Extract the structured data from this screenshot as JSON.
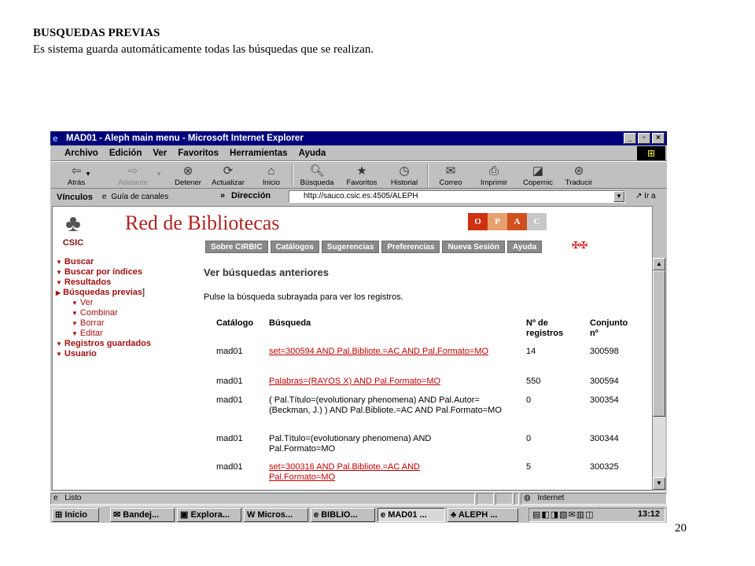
{
  "doc": {
    "title": "BUSQUEDAS PREVIAS",
    "text": "Es sistema guarda automáticamente todas las búsquedas que se realizan.",
    "page_number": "20"
  },
  "window": {
    "title": "MAD01 - Aleph main menu - Microsoft Internet Explorer",
    "menu": [
      "Archivo",
      "Edición",
      "Ver",
      "Favoritos",
      "Herramientas",
      "Ayuda"
    ],
    "toolbar": [
      "Atrás",
      "Adelante",
      "Detener",
      "Actualizar",
      "Inicio",
      "Búsqueda",
      "Favoritos",
      "Historial",
      "Correo",
      "Imprimir",
      "Copernic",
      "Traducir"
    ],
    "links_label": "Vínculos",
    "channel_guide": "Guía de canales",
    "address_label": "Dirección",
    "url": "http://sauco.csic.es:4505/ALEPH",
    "go_label": "Ir a"
  },
  "site": {
    "logo_text": "CSIC",
    "brand": "Red de Bibliotecas",
    "opac": [
      "O",
      "P",
      "A",
      "C"
    ],
    "nav": [
      "Sobre CIRBIC",
      "Catálogos",
      "Sugerencias",
      "Preferencias",
      "Nueva Sesión",
      "Ayuda"
    ]
  },
  "sidebar": [
    {
      "label": "Buscar",
      "sub": false
    },
    {
      "label": "Buscar por índices",
      "sub": false
    },
    {
      "label": "Resultados",
      "sub": false
    },
    {
      "label": "Búsquedas previas",
      "sub": false,
      "active": true
    },
    {
      "label": "Ver",
      "sub": true
    },
    {
      "label": "Combinar",
      "sub": true
    },
    {
      "label": "Borrar",
      "sub": true
    },
    {
      "label": "Editar",
      "sub": true
    },
    {
      "label": "Registros guardados",
      "sub": false
    },
    {
      "label": "Usuario",
      "sub": false
    }
  ],
  "main": {
    "heading": "Ver búsquedas anteriores",
    "hint": "Pulse la búsqueda subrayada para ver los registros.",
    "columns": [
      "Catálogo",
      "Búsqueda",
      "Nº de registros",
      "Conjunto nº"
    ],
    "rows": [
      {
        "catalog": "mad01",
        "query": "set=300594 AND Pal.Bibliote.=AC AND Pal.Formato=MO",
        "link": true,
        "records": "14",
        "set": "300598"
      },
      {
        "catalog": "mad01",
        "query": "Palabras=(RAYOS X) AND Pal.Formato=MO",
        "link": true,
        "records": "550",
        "set": "300594"
      },
      {
        "catalog": "mad01",
        "query": "( Pal.Título=(evolutionary phenomena) AND Pal.Autor=(Beckman, J.) ) AND Pal.Bibliote.=AC AND Pal.Formato=MO",
        "link": false,
        "records": "0",
        "set": "300354"
      },
      {
        "catalog": "mad01",
        "query": "Pal.Título=(evolutionary phenomena) AND Pal.Formato=MO",
        "link": false,
        "records": "0",
        "set": "300344"
      },
      {
        "catalog": "mad01",
        "query": "set=300316 AND Pal.Bibliote.=AC AND Pal.Formato=MO",
        "link": true,
        "records": "5",
        "set": "300325"
      }
    ]
  },
  "status": {
    "text": "Listo",
    "zone": "Internet"
  },
  "taskbar": {
    "start": "Inicio",
    "items": [
      "Bandej...",
      "Explora...",
      "Micros...",
      "BIBLIO...",
      "MAD01 ...",
      "ALEPH ..."
    ],
    "clock": "13:12"
  },
  "colors": {
    "title_bar": "#00007b",
    "link": "#c00000",
    "brand": "#b22222",
    "opac_o": "#d03010",
    "opac_p": "#e8a070",
    "opac_a": "#d05020",
    "opac_c": "#c8c8c8"
  }
}
